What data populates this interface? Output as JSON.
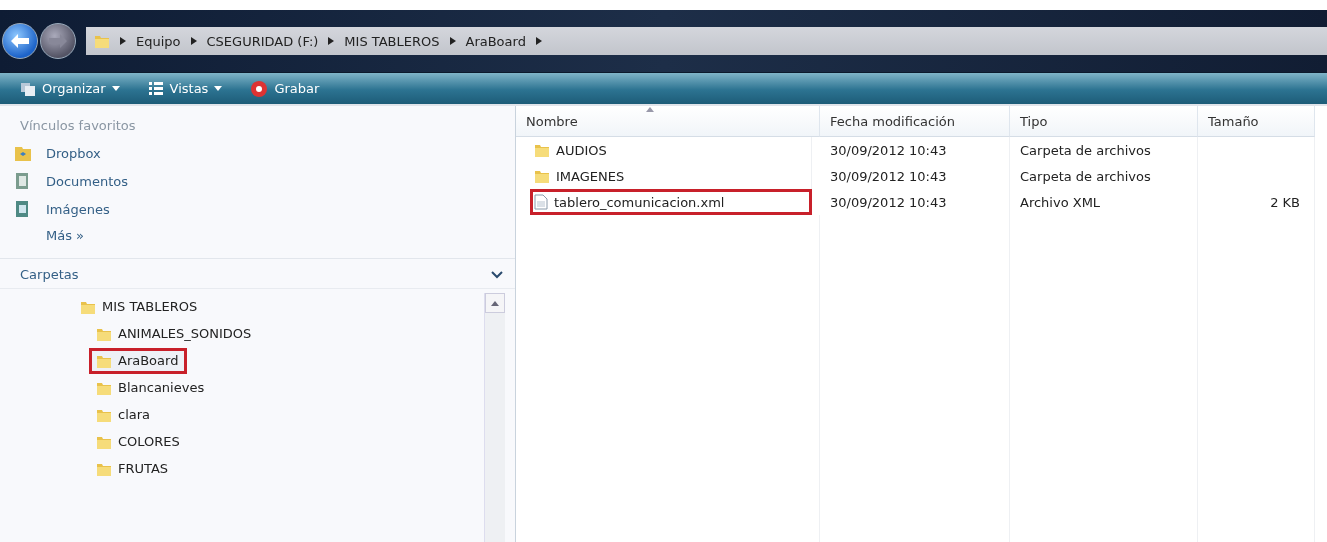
{
  "address_bar": {
    "segments": [
      "Equipo",
      "CSEGURIDAD (F:)",
      "MIS TABLEROS",
      "AraBoard"
    ]
  },
  "toolbar": [
    {
      "label": "Organizar",
      "kind": "menu"
    },
    {
      "label": "Vistas",
      "kind": "menu"
    },
    {
      "label": "Grabar",
      "kind": "action"
    }
  ],
  "favorites": {
    "title": "Vínculos favoritos",
    "items": [
      {
        "label": "Dropbox",
        "kind": "dropbox"
      },
      {
        "label": "Documentos",
        "kind": "documents"
      },
      {
        "label": "Imágenes",
        "kind": "pictures"
      }
    ],
    "more": "Más",
    "more_glyph": "»"
  },
  "folders": {
    "title": "Carpetas",
    "tree": [
      {
        "label": "MIS TABLEROS",
        "highlighted": false,
        "children": [
          {
            "label": "ANIMALES_SONIDOS",
            "highlighted": false
          },
          {
            "label": "AraBoard",
            "highlighted": true
          },
          {
            "label": "Blancanieves",
            "highlighted": false
          },
          {
            "label": "clara",
            "highlighted": false
          },
          {
            "label": "COLORES",
            "highlighted": false
          },
          {
            "label": "FRUTAS",
            "highlighted": false
          }
        ]
      }
    ]
  },
  "table": {
    "columns": [
      "Nombre",
      "Fecha modificación",
      "Tipo",
      "Tamaño"
    ],
    "rows": [
      {
        "kind": "folder",
        "name": "AUDIOS",
        "date": "30/09/2012 10:43",
        "type": "Carpeta de archivos",
        "highlighted": false
      },
      {
        "kind": "folder",
        "name": "IMAGENES",
        "date": "30/09/2012 10:43",
        "type": "Carpeta de archivos",
        "highlighted": false
      },
      {
        "kind": "file",
        "name": "tablero_comunicacion.xml",
        "date": "30/09/2012 10:43",
        "type": "Archivo XML",
        "size": "2 KB",
        "highlighted": true
      }
    ]
  }
}
